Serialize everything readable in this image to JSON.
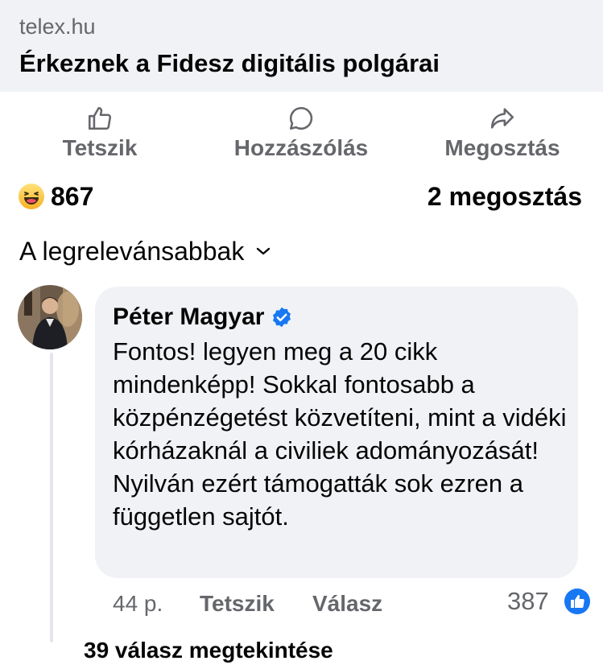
{
  "link_card": {
    "domain": "telex.hu",
    "title": "Érkeznek a Fidesz digitális polgárai"
  },
  "actions": {
    "like_label": "Tetszik",
    "comment_label": "Hozzászólás",
    "share_label": "Megosztás"
  },
  "stats": {
    "reaction_icon": "haha-emoji",
    "reaction_count": "867",
    "share_count": "2 megosztás"
  },
  "sort": {
    "label": "A legrelevánsabbak",
    "icon": "chevron-down-icon"
  },
  "comment": {
    "author": "Péter Magyar",
    "verified_icon": "verified-badge-icon",
    "text": "Fontos! legyen meg a 20 cikk mindenképp! Sokkal fontosabb a közpénzégetést közvetíteni, mint a vidéki kórházaknál a civiliek adományozását! Nyilván ezért támogatták sok ezren a független sajtót.",
    "time": "44 p.",
    "like_label": "Tetszik",
    "reply_label": "Válasz",
    "like_count": "387",
    "like_badge_icon": "like-badge-icon",
    "view_replies": "39 válasz megtekintése"
  },
  "colors": {
    "accent_blue": "#1877f2",
    "secondary_text": "#65676b",
    "bubble_bg": "#f0f2f5"
  }
}
